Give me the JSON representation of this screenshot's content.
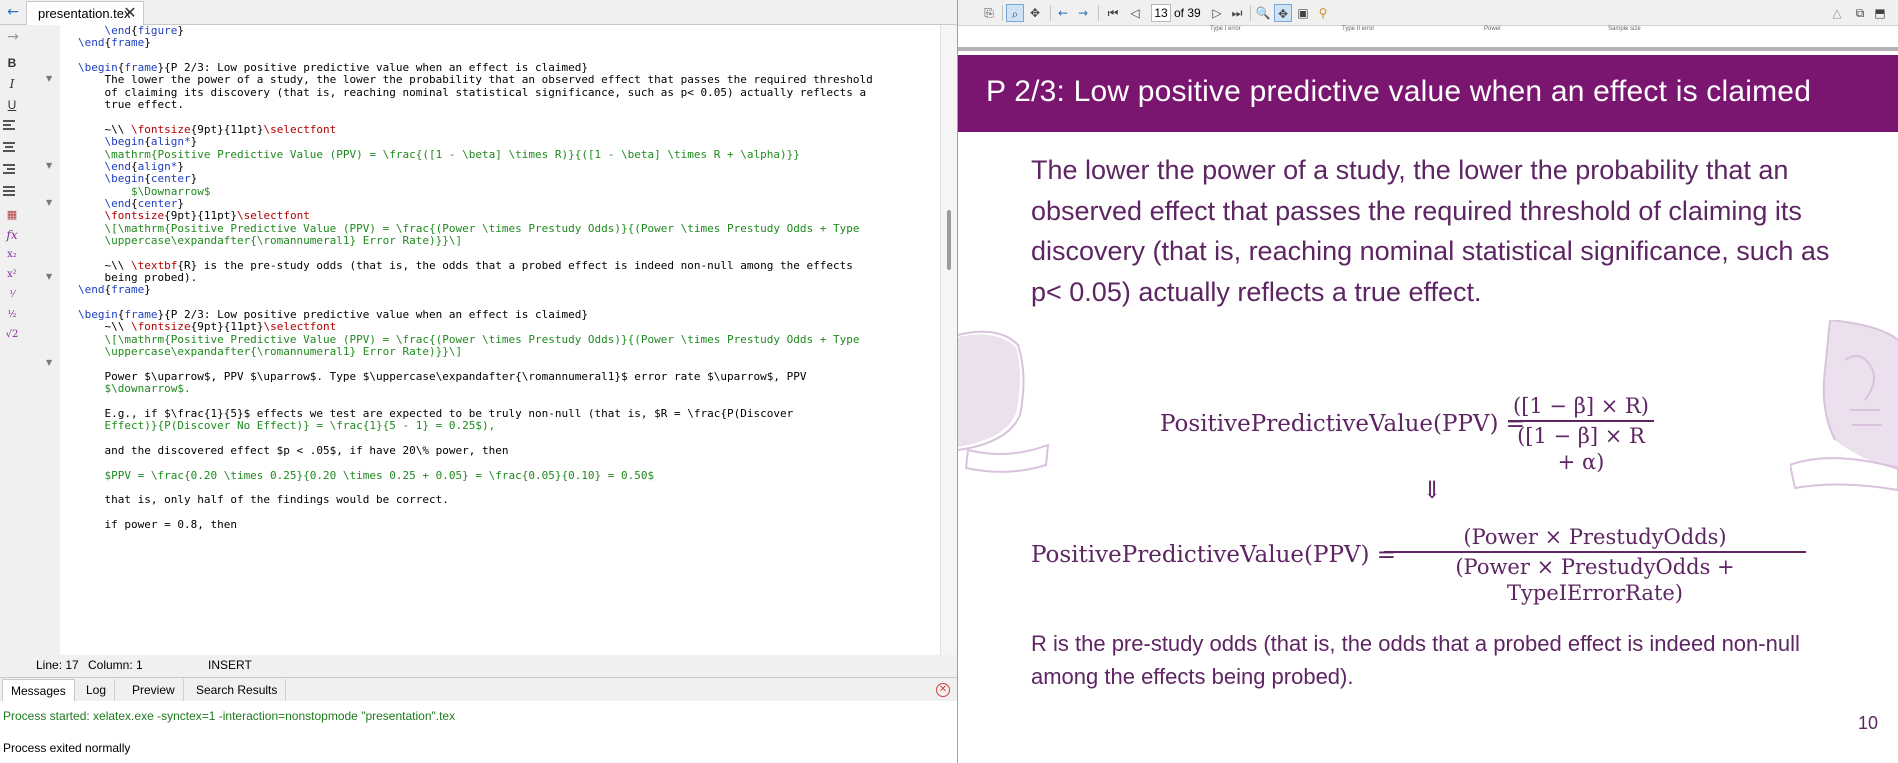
{
  "editor": {
    "tab_label": "presentation.tex",
    "code_lines": [
      {
        "id": "l01",
        "text": "    \\end{figure}"
      },
      {
        "id": "l02",
        "text": "\\end{frame}"
      },
      {
        "id": "l03",
        "text": ""
      },
      {
        "id": "l04",
        "text": "\\begin{frame}{P 2/3: Low positive predictive value when an effect is claimed}"
      },
      {
        "id": "l05",
        "text": "    The lower the power of a study, the lower the probability that an observed effect that passes the required threshold"
      },
      {
        "id": "l06",
        "text": "    of claiming its discovery (that is, reaching nominal statistical significance, such as p< 0.05) actually reflects a"
      },
      {
        "id": "l07",
        "text": "    true effect."
      },
      {
        "id": "l08",
        "text": ""
      },
      {
        "id": "l09",
        "text": "    ~\\\\ \\fontsize{9pt}{11pt}\\selectfont"
      },
      {
        "id": "l10",
        "text": "    \\begin{align*}"
      },
      {
        "id": "l11",
        "text": "    \\mathrm{Positive Predictive Value (PPV) = \\frac{([1 - \\beta] \\times R)}{([1 - \\beta] \\times R + \\alpha)}}"
      },
      {
        "id": "l12",
        "text": "    \\end{align*}"
      },
      {
        "id": "l13",
        "text": "    \\begin{center}"
      },
      {
        "id": "l14",
        "text": "        $\\Downarrow$"
      },
      {
        "id": "l15",
        "text": "    \\end{center}"
      },
      {
        "id": "l16",
        "text": "    \\fontsize{9pt}{11pt}\\selectfont"
      },
      {
        "id": "l17",
        "text": "    \\[\\mathrm{Positive Predictive Value (PPV) = \\frac{(Power \\times Prestudy Odds)}{(Power \\times Prestudy Odds + Type"
      },
      {
        "id": "l18",
        "text": "    \\uppercase\\expandafter{\\romannumeral1} Error Rate)}}\\]"
      },
      {
        "id": "l19",
        "text": ""
      },
      {
        "id": "l20",
        "text": "    ~\\\\ \\textbf{R} is the pre-study odds (that is, the odds that a probed effect is indeed non-null among the effects"
      },
      {
        "id": "l21",
        "text": "    being probed)."
      },
      {
        "id": "l22",
        "text": "\\end{frame}"
      },
      {
        "id": "l23",
        "text": ""
      },
      {
        "id": "l24",
        "text": "\\begin{frame}{P 2/3: Low positive predictive value when an effect is claimed}"
      },
      {
        "id": "l25",
        "text": "    ~\\\\ \\fontsize{9pt}{11pt}\\selectfont"
      },
      {
        "id": "l26",
        "text": "    \\[\\mathrm{Positive Predictive Value (PPV) = \\frac{(Power \\times Prestudy Odds)}{(Power \\times Prestudy Odds + Type"
      },
      {
        "id": "l27",
        "text": "    \\uppercase\\expandafter{\\romannumeral1} Error Rate)}}\\]"
      },
      {
        "id": "l28",
        "text": ""
      },
      {
        "id": "l29",
        "text": "    Power $\\uparrow$, PPV $\\uparrow$. Type $\\uppercase\\expandafter{\\romannumeral1}$ error rate $\\uparrow$, PPV"
      },
      {
        "id": "l30",
        "text": "    $\\downarrow$."
      },
      {
        "id": "l31",
        "text": ""
      },
      {
        "id": "l32",
        "text": "    E.g., if $\\frac{1}{5}$ effects we test are expected to be truly non-null (that is, $R = \\frac{P(Discover"
      },
      {
        "id": "l33",
        "text": "    Effect)}{P(Discover No Effect)} = \\frac{1}{5 - 1} = 0.25$),"
      },
      {
        "id": "l34",
        "text": ""
      },
      {
        "id": "l35",
        "text": "    and the discovered effect $p < .05$, if have 20\\% power, then"
      },
      {
        "id": "l36",
        "text": ""
      },
      {
        "id": "l37",
        "text": "    $PPV = \\frac{0.20 \\times 0.25}{0.20 \\times 0.25 + 0.05} = \\frac{0.05}{0.10} = 0.50$"
      },
      {
        "id": "l38",
        "text": ""
      },
      {
        "id": "l39",
        "text": "    that is, only half of the findings would be correct."
      },
      {
        "id": "l40",
        "text": ""
      },
      {
        "id": "l41",
        "text": "    if power = 0.8, then"
      }
    ]
  },
  "statusbar": {
    "line": "Line: 17",
    "column": "Column: 1",
    "mode": "INSERT"
  },
  "messages": {
    "tabs": [
      "Messages",
      "Log",
      "Preview",
      "Search Results"
    ],
    "line1": "Process started: xelatex.exe -synctex=1 -interaction=nonstopmode \"presentation\".tex",
    "line2": "Process exited normally"
  },
  "pdf_toolbar": {
    "page_current": "13",
    "page_of": "of 39"
  },
  "strip": {
    "labels": [
      "Type I error",
      "Type II error",
      "Power",
      "Sample size"
    ]
  },
  "slide": {
    "title": "P 2/3: Low positive predictive value when an effect is claimed",
    "body": "The lower the power of a study, the lower the probability that an observed effect that passes the required threshold of claiming its discovery (that is, reaching nominal statistical significance, such as p< 0.05) actually reflects a true effect.",
    "eq1_lhs": "PositivePredictiveValue(PPV) =",
    "eq1_num": "([1 − β] × R)",
    "eq1_den": "([1 − β] × R + α)",
    "arrow": "⇓",
    "eq2_lhs": "PositivePredictiveValue(PPV) =",
    "eq2_num": "(Power × PrestudyOdds)",
    "eq2_den": "(Power × PrestudyOdds + TypeIErrorRate)",
    "note_r": "R",
    "note_rest": " is the pre-study odds (that is, the odds that a probed effect is indeed non-null among the effects being probed).",
    "page_number": "10"
  },
  "colors": {
    "header_bg": "#7b1670",
    "slide_text": "#5e2563",
    "code_keyword": "#1f3fbf",
    "code_math": "#1e8a1e",
    "code_command": "#b00000"
  }
}
